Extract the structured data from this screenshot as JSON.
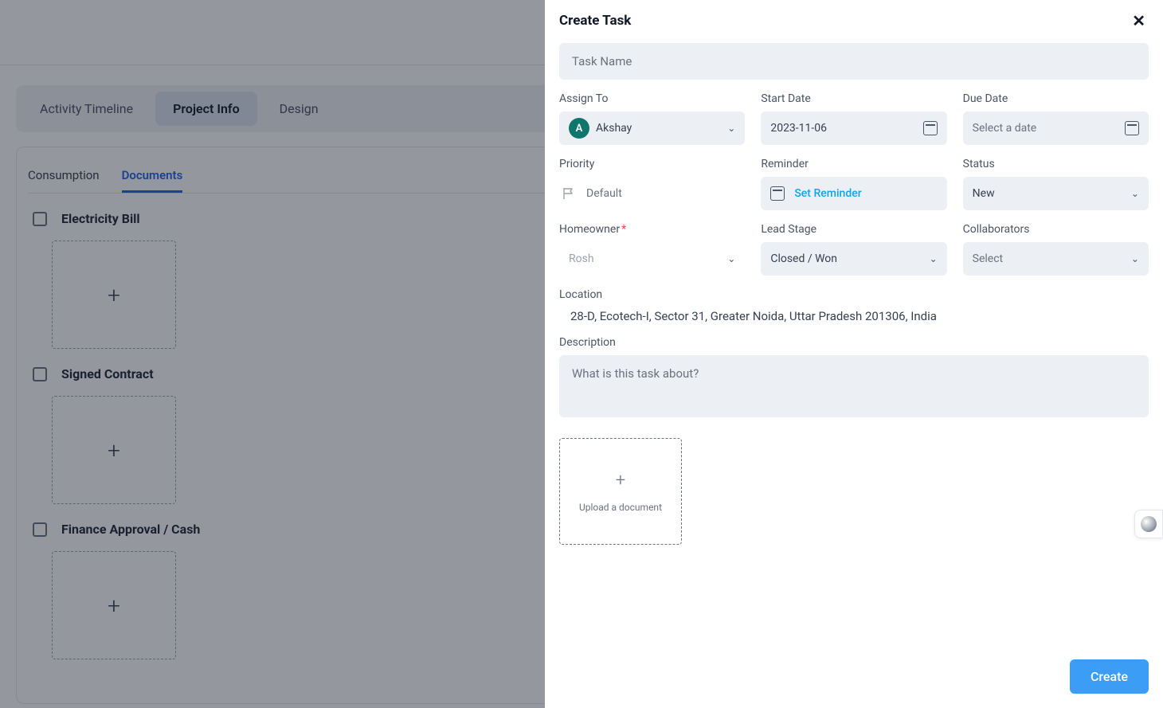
{
  "tabs": {
    "activity": "Activity Timeline",
    "project": "Project Info",
    "design": "Design"
  },
  "subtabs": {
    "consumption": "Consumption",
    "documents": "Documents"
  },
  "docs": {
    "d1": "Electricity Bill",
    "d2": "Signed Contract",
    "d3": "Finance Approval / Cash"
  },
  "panel": {
    "title": "Create Task",
    "taskNamePlaceholder": "Task Name",
    "labels": {
      "assignTo": "Assign To",
      "startDate": "Start Date",
      "dueDate": "Due Date",
      "priority": "Priority",
      "reminder": "Reminder",
      "status": "Status",
      "homeowner": "Homeowner",
      "leadStage": "Lead Stage",
      "collaborators": "Collaborators",
      "location": "Location",
      "description": "Description"
    },
    "values": {
      "assignInitial": "A",
      "assignName": "Akshay",
      "startDate": "2023-11-06",
      "dueDatePlaceholder": "Select a date",
      "priority": "Default",
      "reminderLink": "Set Reminder",
      "status": "New",
      "homeowner": "Rosh",
      "leadStage": "Closed / Won",
      "collaboratorsPlaceholder": "Select",
      "locationText": "28-D, Ecotech-I, Sector 31, Greater Noida, Uttar Pradesh 201306, India",
      "descPlaceholder": "What is this task about?",
      "uploadLabel": "Upload a document"
    },
    "createBtn": "Create"
  }
}
